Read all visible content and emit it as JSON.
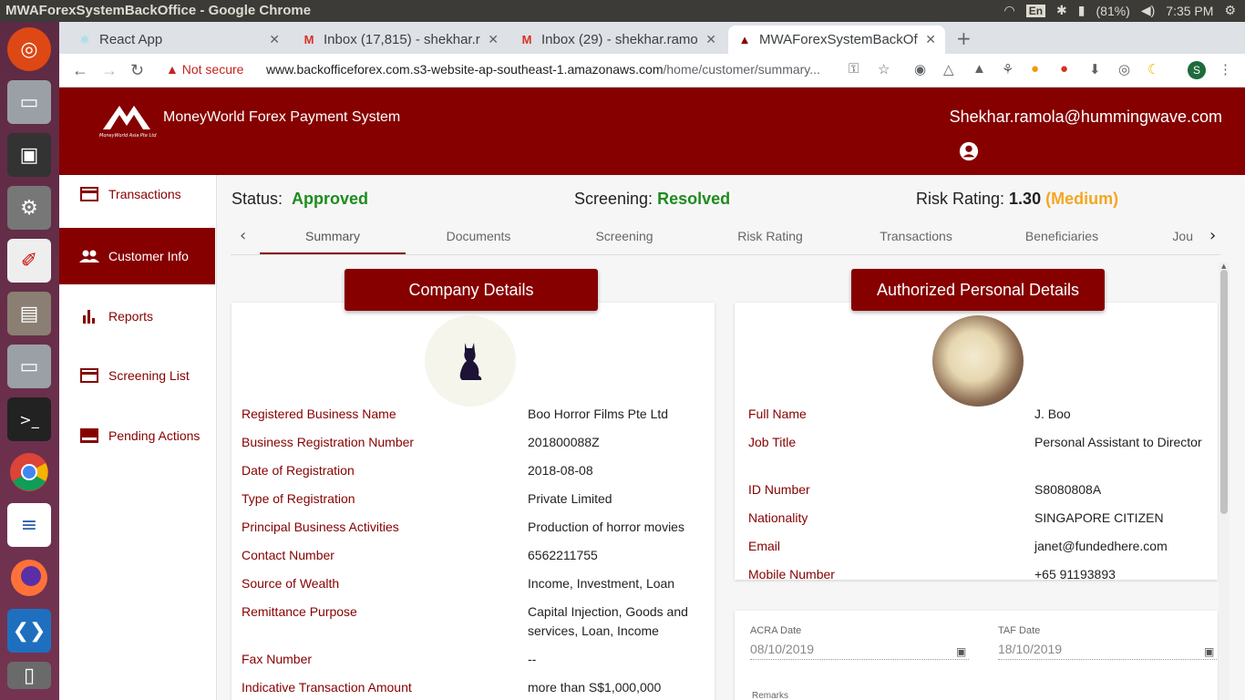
{
  "os": {
    "window_title": "MWAForexSystemBackOffice - Google Chrome",
    "lang": "En",
    "battery": "(81%)",
    "clock": "7:35 PM"
  },
  "browser": {
    "tabs": [
      {
        "label": "React App",
        "icon": "react-icon"
      },
      {
        "label": "Inbox (17,815) - shekhar.r",
        "icon": "gmail-icon"
      },
      {
        "label": "Inbox (29) - shekhar.ramo",
        "icon": "gmail-icon"
      },
      {
        "label": "MWAForexSystemBackOf",
        "icon": "mwa-icon"
      }
    ],
    "not_secure": "Not secure",
    "url_host": "www.backofficeforex.com.s3-website-ap-southeast-1.amazonaws.com",
    "url_path": "/home/customer/summary...",
    "profile_initial": "S"
  },
  "app": {
    "logo_caption": "MoneyWorld Asia Pte Ltd",
    "name": "MoneyWorld Forex Payment System",
    "user_email": "Shekhar.ramola@hummingwave.com",
    "brand_color": "#860000"
  },
  "sidebar": {
    "items": [
      {
        "label": "Transactions",
        "icon": "card-icon"
      },
      {
        "label": "Customer Info",
        "icon": "people-icon"
      },
      {
        "label": "Reports",
        "icon": "bar-chart-icon"
      },
      {
        "label": "Screening List",
        "icon": "card-icon"
      },
      {
        "label": "Pending Actions",
        "icon": "pending-icon"
      }
    ],
    "active": "Customer Info"
  },
  "status": {
    "status_label": "Status:",
    "status_value": "Approved",
    "screening_label": "Screening:",
    "screening_value": "Resolved",
    "risk_label": "Risk Rating:",
    "risk_value": "1.30",
    "risk_level": "(Medium)"
  },
  "content_tabs": [
    "Summary",
    "Documents",
    "Screening",
    "Risk Rating",
    "Transactions",
    "Beneficiaries",
    "Jou"
  ],
  "active_tab": "Summary",
  "company": {
    "title": "Company Details",
    "rows": [
      {
        "k": "Registered Business Name",
        "v": "Boo Horror Films Pte Ltd"
      },
      {
        "k": "Business Registration Number",
        "v": "201800088Z"
      },
      {
        "k": "Date of Registration",
        "v": "2018-08-08"
      },
      {
        "k": "Type of Registration",
        "v": "Private Limited"
      },
      {
        "k": "Principal Business Activities",
        "v": "Production of horror movies"
      },
      {
        "k": "Contact Number",
        "v": "6562211755"
      },
      {
        "k": "Source of Wealth",
        "v": "Income, Investment, Loan"
      },
      {
        "k": "Remittance Purpose",
        "v": "Capital Injection, Goods and services, Loan, Income"
      },
      {
        "k": "Fax Number",
        "v": "--"
      },
      {
        "k": "Indicative Transaction Amount",
        "v": "more than S$1,000,000"
      }
    ]
  },
  "personal": {
    "title": "Authorized Personal Details",
    "rows": [
      {
        "k": "Full Name",
        "v": "J. Boo"
      },
      {
        "k": "Job Title",
        "v": "Personal Assistant to Director"
      },
      {
        "k": "ID Number",
        "v": "S8080808A"
      },
      {
        "k": "Nationality",
        "v": "SINGAPORE CITIZEN"
      },
      {
        "k": "Email",
        "v": "janet@fundedhere.com"
      },
      {
        "k": "Mobile Number",
        "v": "+65 91193893"
      }
    ]
  },
  "dates": {
    "acra_label": "ACRA Date",
    "acra_value": "08/10/2019",
    "taf_label": "TAF Date",
    "taf_value": "18/10/2019",
    "remarks_label": "Remarks"
  }
}
